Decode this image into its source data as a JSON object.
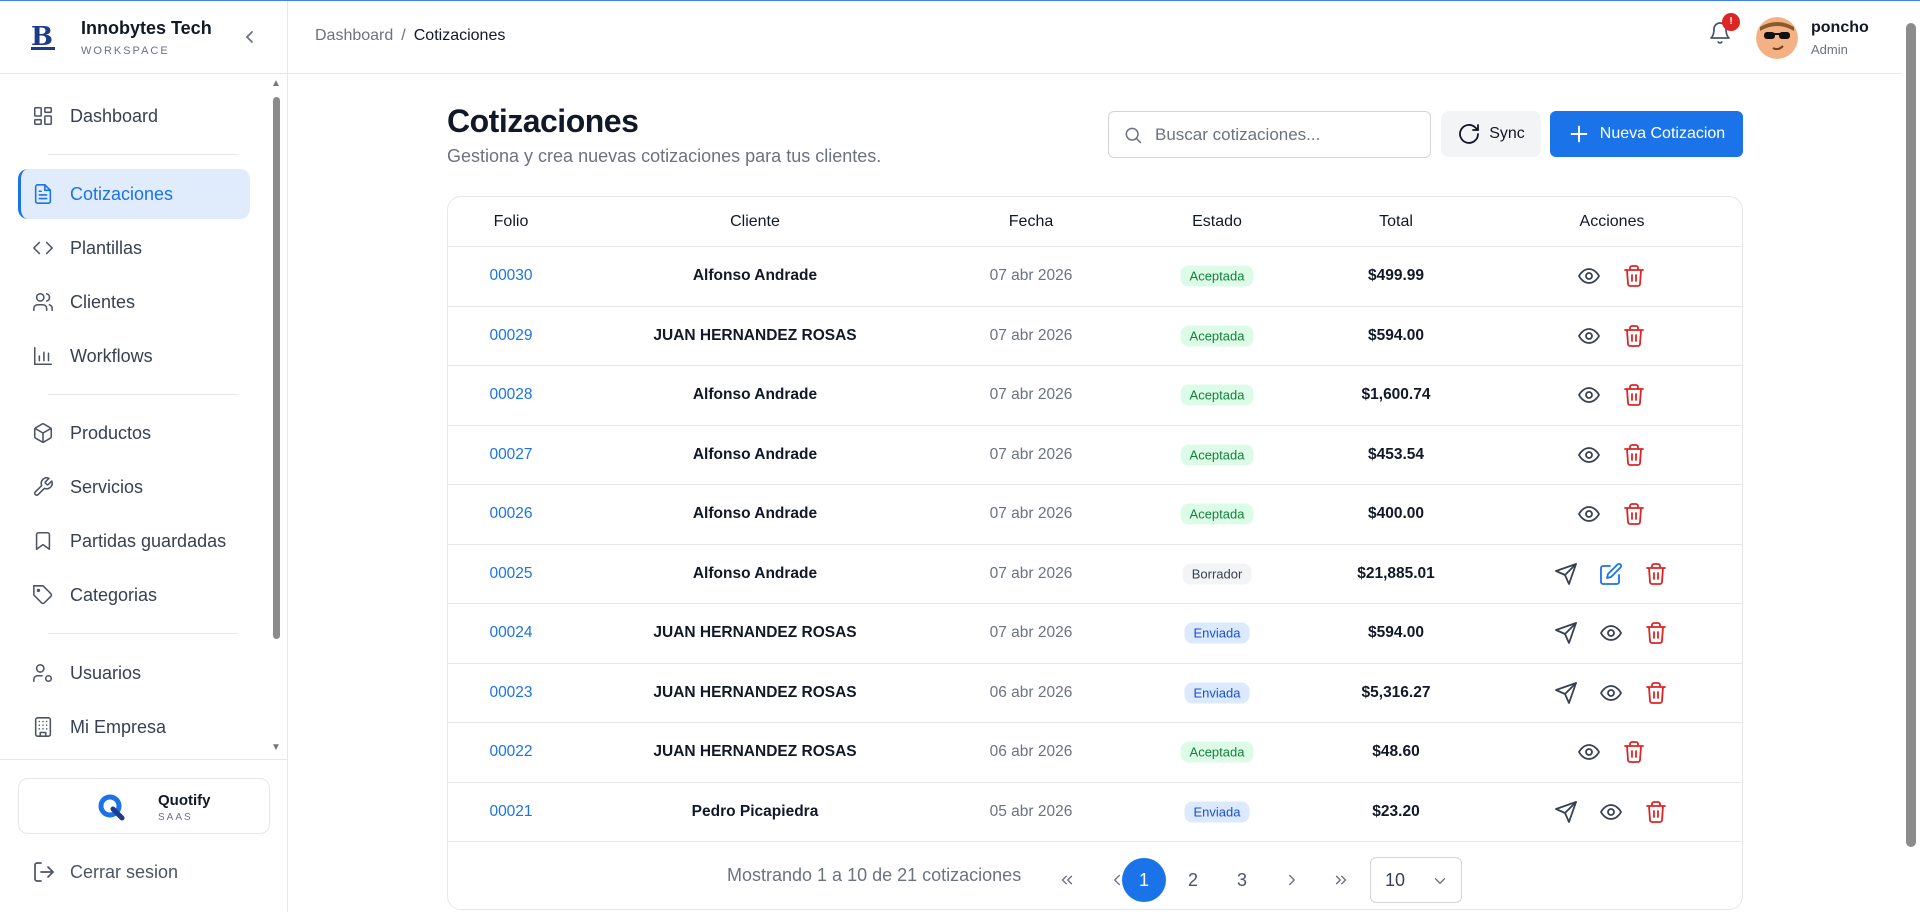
{
  "brand": {
    "name": "Innobytes Tech",
    "subtitle": "WORKSPACE"
  },
  "sidebar": {
    "items": [
      {
        "label": "Dashboard",
        "icon": "dashboard-grid-icon"
      },
      {
        "label": "Cotizaciones",
        "icon": "document-icon",
        "active": true
      },
      {
        "label": "Plantillas",
        "icon": "code-icon"
      },
      {
        "label": "Clientes",
        "icon": "users-icon"
      },
      {
        "label": "Workflows",
        "icon": "bar-chart-icon"
      },
      {
        "label": "Productos",
        "icon": "box-icon"
      },
      {
        "label": "Servicios",
        "icon": "wrench-icon"
      },
      {
        "label": "Partidas guardadas",
        "icon": "bookmark-icon"
      },
      {
        "label": "Categorias",
        "icon": "tag-icon"
      },
      {
        "label": "Usuarios",
        "icon": "user-cog-icon"
      },
      {
        "label": "Mi Empresa",
        "icon": "building-icon"
      }
    ],
    "app_card": {
      "name": "Quotify",
      "subtitle": "SAAS"
    },
    "logout_label": "Cerrar sesion"
  },
  "header": {
    "breadcrumb": {
      "parent": "Dashboard",
      "separator": "/",
      "current": "Cotizaciones"
    },
    "notifications_count": "!",
    "user": {
      "name": "poncho",
      "role": "Admin"
    }
  },
  "main": {
    "title": "Cotizaciones",
    "subtitle": "Gestiona y crea nuevas cotizaciones para tus clientes.",
    "search_placeholder": "Buscar cotizaciones...",
    "sync_label": "Sync",
    "new_label": "Nueva Cotizacion"
  },
  "table": {
    "columns": [
      "Folio",
      "Cliente",
      "Fecha",
      "Estado",
      "Total",
      "Acciones"
    ],
    "rows": [
      {
        "folio": "00030",
        "cliente": "Alfonso Andrade",
        "fecha": "07 abr 2026",
        "estado": "Aceptada",
        "total": "$499.99",
        "actions": [
          "view",
          "delete"
        ]
      },
      {
        "folio": "00029",
        "cliente": "JUAN HERNANDEZ ROSAS",
        "fecha": "07 abr 2026",
        "estado": "Aceptada",
        "total": "$594.00",
        "actions": [
          "view",
          "delete"
        ]
      },
      {
        "folio": "00028",
        "cliente": "Alfonso Andrade",
        "fecha": "07 abr 2026",
        "estado": "Aceptada",
        "total": "$1,600.74",
        "actions": [
          "view",
          "delete"
        ]
      },
      {
        "folio": "00027",
        "cliente": "Alfonso Andrade",
        "fecha": "07 abr 2026",
        "estado": "Aceptada",
        "total": "$453.54",
        "actions": [
          "view",
          "delete"
        ]
      },
      {
        "folio": "00026",
        "cliente": "Alfonso Andrade",
        "fecha": "07 abr 2026",
        "estado": "Aceptada",
        "total": "$400.00",
        "actions": [
          "view",
          "delete"
        ]
      },
      {
        "folio": "00025",
        "cliente": "Alfonso Andrade",
        "fecha": "07 abr 2026",
        "estado": "Borrador",
        "total": "$21,885.01",
        "actions": [
          "send",
          "edit",
          "delete"
        ]
      },
      {
        "folio": "00024",
        "cliente": "JUAN HERNANDEZ ROSAS",
        "fecha": "07 abr 2026",
        "estado": "Enviada",
        "total": "$594.00",
        "actions": [
          "send",
          "view",
          "delete"
        ]
      },
      {
        "folio": "00023",
        "cliente": "JUAN HERNANDEZ ROSAS",
        "fecha": "06 abr 2026",
        "estado": "Enviada",
        "total": "$5,316.27",
        "actions": [
          "send",
          "view",
          "delete"
        ]
      },
      {
        "folio": "00022",
        "cliente": "JUAN HERNANDEZ ROSAS",
        "fecha": "06 abr 2026",
        "estado": "Aceptada",
        "total": "$48.60",
        "actions": [
          "view",
          "delete"
        ]
      },
      {
        "folio": "00021",
        "cliente": "Pedro Picapiedra",
        "fecha": "05 abr 2026",
        "estado": "Enviada",
        "total": "$23.20",
        "actions": [
          "send",
          "view",
          "delete"
        ]
      }
    ]
  },
  "pagination": {
    "info": "Mostrando 1 a 10 de 21 cotizaciones",
    "pages": [
      "1",
      "2",
      "3"
    ],
    "current_page": "1",
    "page_size": "10"
  },
  "colors": {
    "accent": "#1a73e8",
    "danger": "#dc2626",
    "success_bg": "#dcfce7",
    "info_bg": "#dbeafe"
  }
}
